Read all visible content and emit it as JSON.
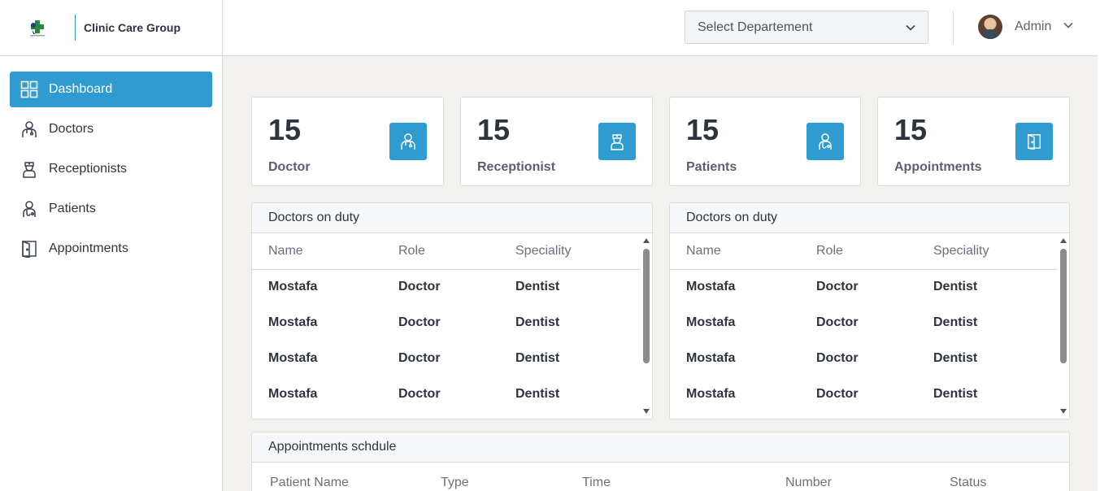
{
  "brand": {
    "name": "Clinic Care Group"
  },
  "sidebar": {
    "items": [
      {
        "label": "Dashboard",
        "icon": "dashboard-grid-icon",
        "active": true
      },
      {
        "label": "Doctors",
        "icon": "doctor-icon",
        "active": false
      },
      {
        "label": "Receptionists",
        "icon": "nurse-icon",
        "active": false
      },
      {
        "label": "Patients",
        "icon": "patient-icon",
        "active": false
      },
      {
        "label": "Appointments",
        "icon": "door-icon",
        "active": false
      }
    ]
  },
  "header": {
    "department_placeholder": "Select Departement",
    "user_name": "Admin"
  },
  "stats": [
    {
      "value": "15",
      "label": "Doctor",
      "icon": "doctor-icon"
    },
    {
      "value": "15",
      "label": "Receptionist",
      "icon": "nurse-icon"
    },
    {
      "value": "15",
      "label": "Patients",
      "icon": "patient-icon"
    },
    {
      "value": "15",
      "label": "Appointments",
      "icon": "door-icon"
    }
  ],
  "duty_left": {
    "title": "Doctors on duty",
    "columns": [
      "Name",
      "Role",
      "Speciality"
    ],
    "rows": [
      [
        "Mostafa",
        "Doctor",
        "Dentist"
      ],
      [
        "Mostafa",
        "Doctor",
        "Dentist"
      ],
      [
        "Mostafa",
        "Doctor",
        "Dentist"
      ],
      [
        "Mostafa",
        "Doctor",
        "Dentist"
      ]
    ]
  },
  "duty_right": {
    "title": "Doctors on duty",
    "columns": [
      "Name",
      "Role",
      "Speciality"
    ],
    "rows": [
      [
        "Mostafa",
        "Doctor",
        "Dentist"
      ],
      [
        "Mostafa",
        "Doctor",
        "Dentist"
      ],
      [
        "Mostafa",
        "Doctor",
        "Dentist"
      ],
      [
        "Mostafa",
        "Doctor",
        "Dentist"
      ]
    ]
  },
  "appointments": {
    "title": "Appointments schdule",
    "columns": [
      "Patient Name",
      "Type",
      "Time",
      "Number",
      "Status"
    ]
  },
  "colors": {
    "accent": "#2f9bd0",
    "sidebar_active": "#2f9bd0",
    "page_bg": "#f2f1ee"
  }
}
